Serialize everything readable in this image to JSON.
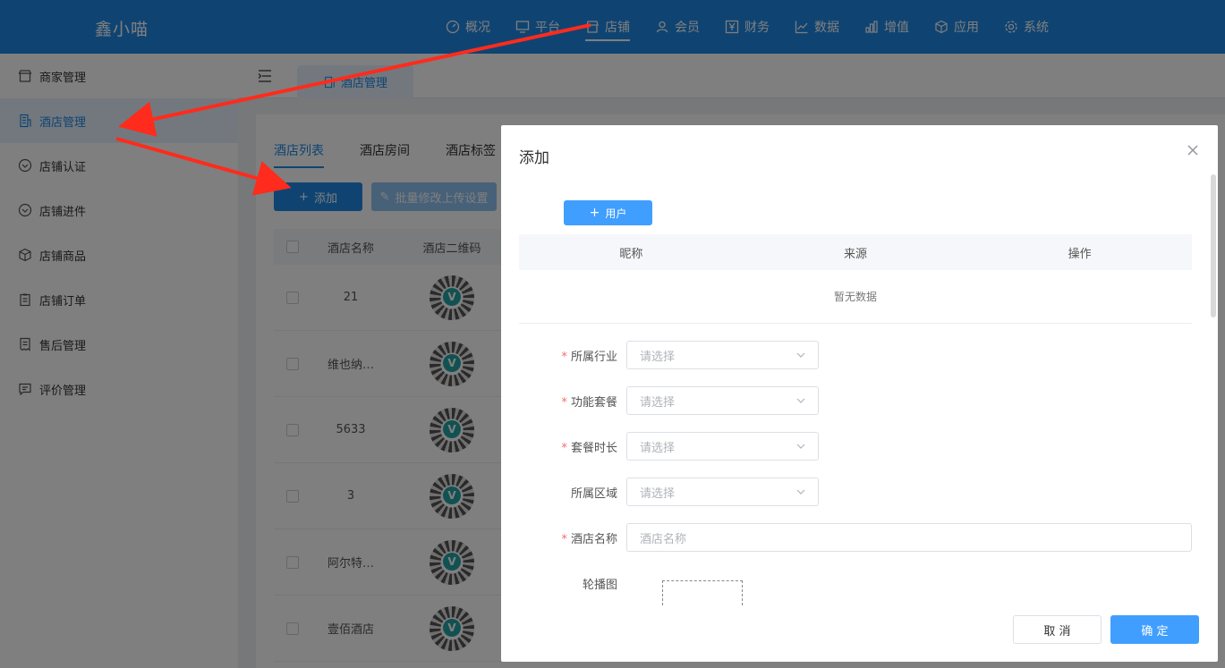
{
  "brand": "鑫小喵",
  "topnav": [
    {
      "label": "概况",
      "icon": "dashboard-icon"
    },
    {
      "label": "平台",
      "icon": "monitor-icon"
    },
    {
      "label": "店铺",
      "icon": "store-icon",
      "active": true
    },
    {
      "label": "会员",
      "icon": "user-icon"
    },
    {
      "label": "财务",
      "icon": "yen-icon"
    },
    {
      "label": "数据",
      "icon": "line-chart-icon"
    },
    {
      "label": "增值",
      "icon": "bar-chart-icon"
    },
    {
      "label": "应用",
      "icon": "cube-icon"
    },
    {
      "label": "系统",
      "icon": "gear-icon"
    }
  ],
  "sidebar": {
    "items": [
      {
        "label": "商家管理",
        "icon": "shop-icon"
      },
      {
        "label": "酒店管理",
        "icon": "building-icon",
        "active": true
      },
      {
        "label": "店铺认证",
        "icon": "check-circle-icon"
      },
      {
        "label": "店铺进件",
        "icon": "check-circle-icon"
      },
      {
        "label": "店铺商品",
        "icon": "box-icon"
      },
      {
        "label": "店铺订单",
        "icon": "clipboard-icon"
      },
      {
        "label": "售后管理",
        "icon": "receipt-icon"
      },
      {
        "label": "评价管理",
        "icon": "comment-icon"
      }
    ]
  },
  "page_tab": "酒店管理",
  "subtabs": [
    "酒店列表",
    "酒店房间",
    "酒店标签"
  ],
  "toolbar": {
    "add": "添加",
    "batch": "批量修改上传设置"
  },
  "grid": {
    "columns": [
      "酒店名称",
      "酒店二维码"
    ],
    "rows": [
      {
        "name": "21"
      },
      {
        "name": "维也纳…"
      },
      {
        "name": "5633"
      },
      {
        "name": "3"
      },
      {
        "name": "阿尔特…"
      },
      {
        "name": "壹佰酒店"
      }
    ]
  },
  "modal": {
    "title": "添加",
    "user_button": "用户",
    "user_table": {
      "columns": [
        "昵称",
        "来源",
        "操作"
      ],
      "empty": "暂无数据"
    },
    "fields": [
      {
        "label": "所属行业",
        "required": true,
        "placeholder": "请选择",
        "type": "select"
      },
      {
        "label": "功能套餐",
        "required": true,
        "placeholder": "请选择",
        "type": "select"
      },
      {
        "label": "套餐时长",
        "required": true,
        "placeholder": "请选择",
        "type": "select"
      },
      {
        "label": "所属区域",
        "required": false,
        "placeholder": "请选择",
        "type": "select"
      },
      {
        "label": "酒店名称",
        "required": true,
        "placeholder": "酒店名称",
        "type": "input"
      }
    ],
    "carousel_label": "轮播图",
    "cancel": "取 消",
    "confirm": "确 定"
  },
  "colors": {
    "primary": "#1e88e5",
    "button": "#409eff",
    "arrow": "#ff2b1c"
  }
}
